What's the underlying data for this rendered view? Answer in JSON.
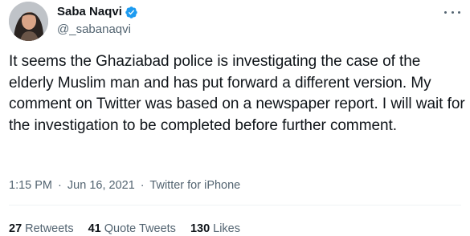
{
  "author": {
    "display_name": "Saba Naqvi",
    "handle": "@_sabanaqvi",
    "verified": true,
    "avatar": "avatar-photo"
  },
  "tweet": {
    "text": "It seems the Ghaziabad police is investigating the case of the elderly Muslim man and has put forward a different version. My comment on Twitter was based on a newspaper report. I will wait for the investigation to be completed before further comment.",
    "time": "1:15 PM",
    "date": "Jun 16, 2021",
    "separator": "·",
    "source": "Twitter for iPhone"
  },
  "stats": {
    "retweets_count": "27",
    "retweets_label": "Retweets",
    "quotes_count": "41",
    "quotes_label": "Quote Tweets",
    "likes_count": "130",
    "likes_label": "Likes"
  },
  "colors": {
    "text": "#0f1419",
    "secondary": "#536471",
    "verified_badge": "#1d9bf0",
    "divider": "#eff3f4"
  },
  "icons": {
    "more": "more-dots-icon",
    "verified": "verified-badge-icon"
  }
}
